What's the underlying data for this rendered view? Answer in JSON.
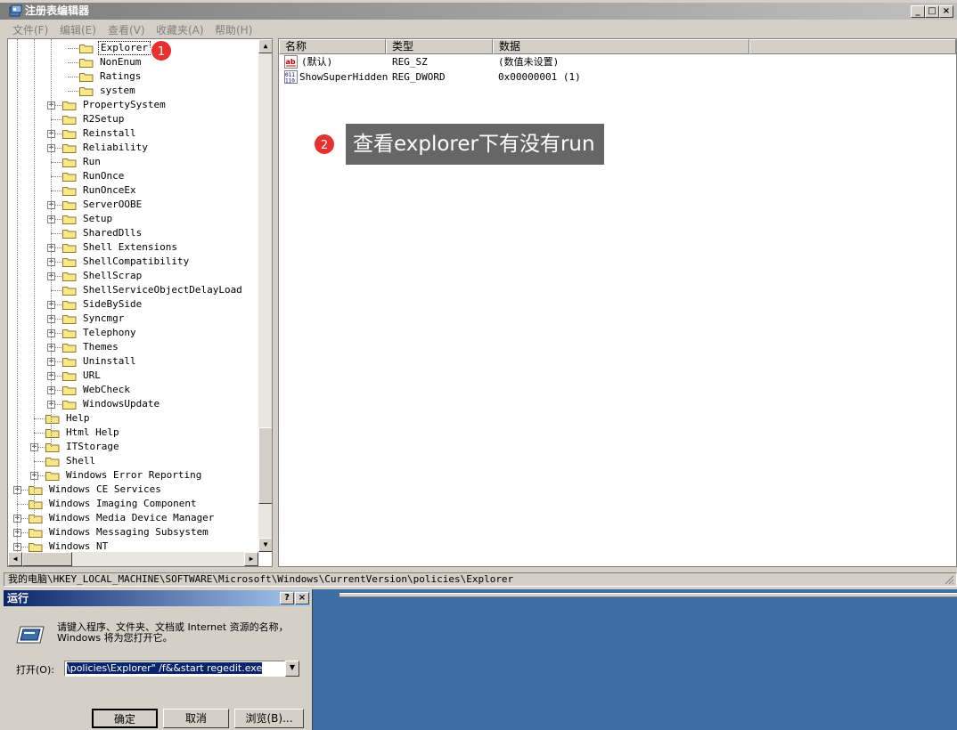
{
  "window": {
    "title": "注册表编辑器",
    "menu": [
      "文件(F)",
      "编辑(E)",
      "查看(V)",
      "收藏夹(A)",
      "帮助(H)"
    ],
    "caption_buttons": [
      "_",
      "□",
      "×"
    ]
  },
  "tree": {
    "nodes": [
      {
        "label": "Explorer",
        "level": 3,
        "expander": "none",
        "selected": true
      },
      {
        "label": "NonEnum",
        "level": 3,
        "expander": "none"
      },
      {
        "label": "Ratings",
        "level": 3,
        "expander": "none"
      },
      {
        "label": "system",
        "level": 3,
        "expander": "none"
      },
      {
        "label": "PropertySystem",
        "level": 2,
        "expander": "+"
      },
      {
        "label": "R2Setup",
        "level": 2,
        "expander": "none"
      },
      {
        "label": "Reinstall",
        "level": 2,
        "expander": "+"
      },
      {
        "label": "Reliability",
        "level": 2,
        "expander": "+"
      },
      {
        "label": "Run",
        "level": 2,
        "expander": "none"
      },
      {
        "label": "RunOnce",
        "level": 2,
        "expander": "none"
      },
      {
        "label": "RunOnceEx",
        "level": 2,
        "expander": "none"
      },
      {
        "label": "ServerOOBE",
        "level": 2,
        "expander": "+"
      },
      {
        "label": "Setup",
        "level": 2,
        "expander": "+"
      },
      {
        "label": "SharedDlls",
        "level": 2,
        "expander": "none"
      },
      {
        "label": "Shell Extensions",
        "level": 2,
        "expander": "+"
      },
      {
        "label": "ShellCompatibility",
        "level": 2,
        "expander": "+"
      },
      {
        "label": "ShellScrap",
        "level": 2,
        "expander": "+"
      },
      {
        "label": "ShellServiceObjectDelayLoad",
        "level": 2,
        "expander": "none"
      },
      {
        "label": "SideBySide",
        "level": 2,
        "expander": "+"
      },
      {
        "label": "Syncmgr",
        "level": 2,
        "expander": "+"
      },
      {
        "label": "Telephony",
        "level": 2,
        "expander": "+"
      },
      {
        "label": "Themes",
        "level": 2,
        "expander": "+"
      },
      {
        "label": "Uninstall",
        "level": 2,
        "expander": "+"
      },
      {
        "label": "URL",
        "level": 2,
        "expander": "+"
      },
      {
        "label": "WebCheck",
        "level": 2,
        "expander": "+"
      },
      {
        "label": "WindowsUpdate",
        "level": 2,
        "expander": "+"
      },
      {
        "label": "Help",
        "level": 1,
        "expander": "none"
      },
      {
        "label": "Html Help",
        "level": 1,
        "expander": "none"
      },
      {
        "label": "ITStorage",
        "level": 1,
        "expander": "+"
      },
      {
        "label": "Shell",
        "level": 1,
        "expander": "none"
      },
      {
        "label": "Windows Error Reporting",
        "level": 1,
        "expander": "+"
      },
      {
        "label": "Windows CE Services",
        "level": 0,
        "expander": "+"
      },
      {
        "label": "Windows Imaging Component",
        "level": 0,
        "expander": "none"
      },
      {
        "label": "Windows Media Device Manager",
        "level": 0,
        "expander": "+"
      },
      {
        "label": "Windows Messaging Subsystem",
        "level": 0,
        "expander": "+"
      },
      {
        "label": "Windows NT",
        "level": 0,
        "expander": "+"
      }
    ]
  },
  "list": {
    "columns": [
      "名称",
      "类型",
      "数据"
    ],
    "rows": [
      {
        "icon": "string-value-icon",
        "name": "(默认)",
        "type": "REG_SZ",
        "data": "(数值未设置)"
      },
      {
        "icon": "dword-value-icon",
        "name": "ShowSuperHidden",
        "type": "REG_DWORD",
        "data": "0x00000001 (1)"
      }
    ]
  },
  "status_path": "我的电脑\\HKEY_LOCAL_MACHINE\\SOFTWARE\\Microsoft\\Windows\\CurrentVersion\\policies\\Explorer",
  "annotations": {
    "badge1": "1",
    "badge2": "2",
    "callout": "查看explorer下有没有run"
  },
  "run_dialog": {
    "title": "运行",
    "help_btn": "?",
    "close_btn": "×",
    "prompt": "请键入程序、文件夹、文档或 Internet 资源的名称，Windows 将为您打开它。",
    "open_label": "打开(O):",
    "input_value": "\\policies\\Explorer\" /f&&start regedit.exe",
    "ok": "确定",
    "cancel": "取消",
    "browse": "浏览(B)..."
  },
  "colors": {
    "desktop": "#3a6ea5",
    "badge": "#e8302f",
    "callout_bg": "#666666"
  }
}
